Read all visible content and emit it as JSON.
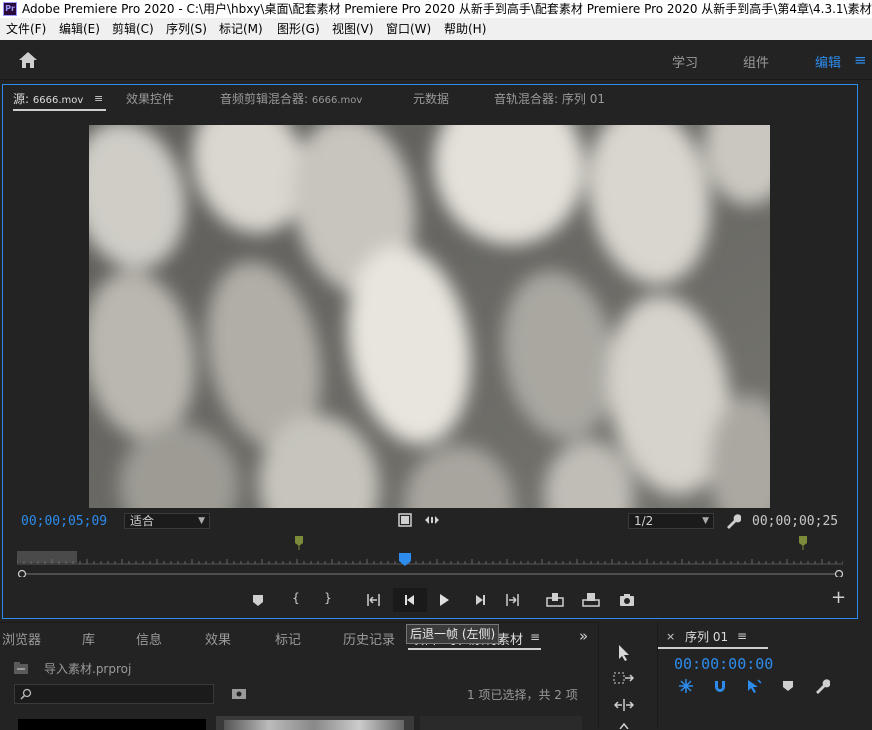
{
  "window": {
    "title": "Adobe Premiere Pro 2020 - C:\\用户\\hbxy\\桌面\\配套素材 Premiere Pro 2020 从新手到高手\\配套素材 Premiere Pro 2020 从新手到高手\\第4章\\4.3.1\\素材\\",
    "logo": "Pr"
  },
  "menu": {
    "items": [
      "文件(F)",
      "编辑(E)",
      "剪辑(C)",
      "序列(S)",
      "标记(M)",
      "图形(G)",
      "视图(V)",
      "窗口(W)",
      "帮助(H)"
    ]
  },
  "workspace": {
    "tabs": [
      "学习",
      "组件",
      "编辑"
    ],
    "active": "编辑",
    "menu_icon": "≡"
  },
  "source_panel": {
    "tabs": [
      {
        "label": "源:",
        "sub": "6666.mov"
      },
      {
        "label": "效果控件",
        "sub": ""
      },
      {
        "label": "音频剪辑混合器:",
        "sub": "6666.mov"
      },
      {
        "label": "元数据",
        "sub": ""
      },
      {
        "label": "音轨混合器:",
        "sub": "序列 01"
      }
    ],
    "tab_menu_icon": "≡",
    "timecode_current": "00;00;05;09",
    "zoom_select": "适合",
    "resolution_select": "1/2",
    "timecode_duration": "00;00;00;25",
    "add_icon": "+"
  },
  "bottom_panel": {
    "tabs": [
      "浏览器",
      "库",
      "信息",
      "效果",
      "标记",
      "历史记录",
      "项目: 导入素材",
      "素材"
    ],
    "tab_menu_icon": "≡",
    "overflow_icon": "»",
    "project_name": "导入素材.prproj",
    "selection_status": "1 项已选择，共 2 项",
    "tooltip": "后退一帧 (左侧)"
  },
  "sequence_panel": {
    "close_icon": "×",
    "title": "序列 01",
    "menu_icon": "≡",
    "timecode": "00:00:00:00"
  },
  "colors": {
    "accent": "#2d8ceb",
    "panel_bg": "#232323",
    "marker_green": "#7c8b3a"
  }
}
